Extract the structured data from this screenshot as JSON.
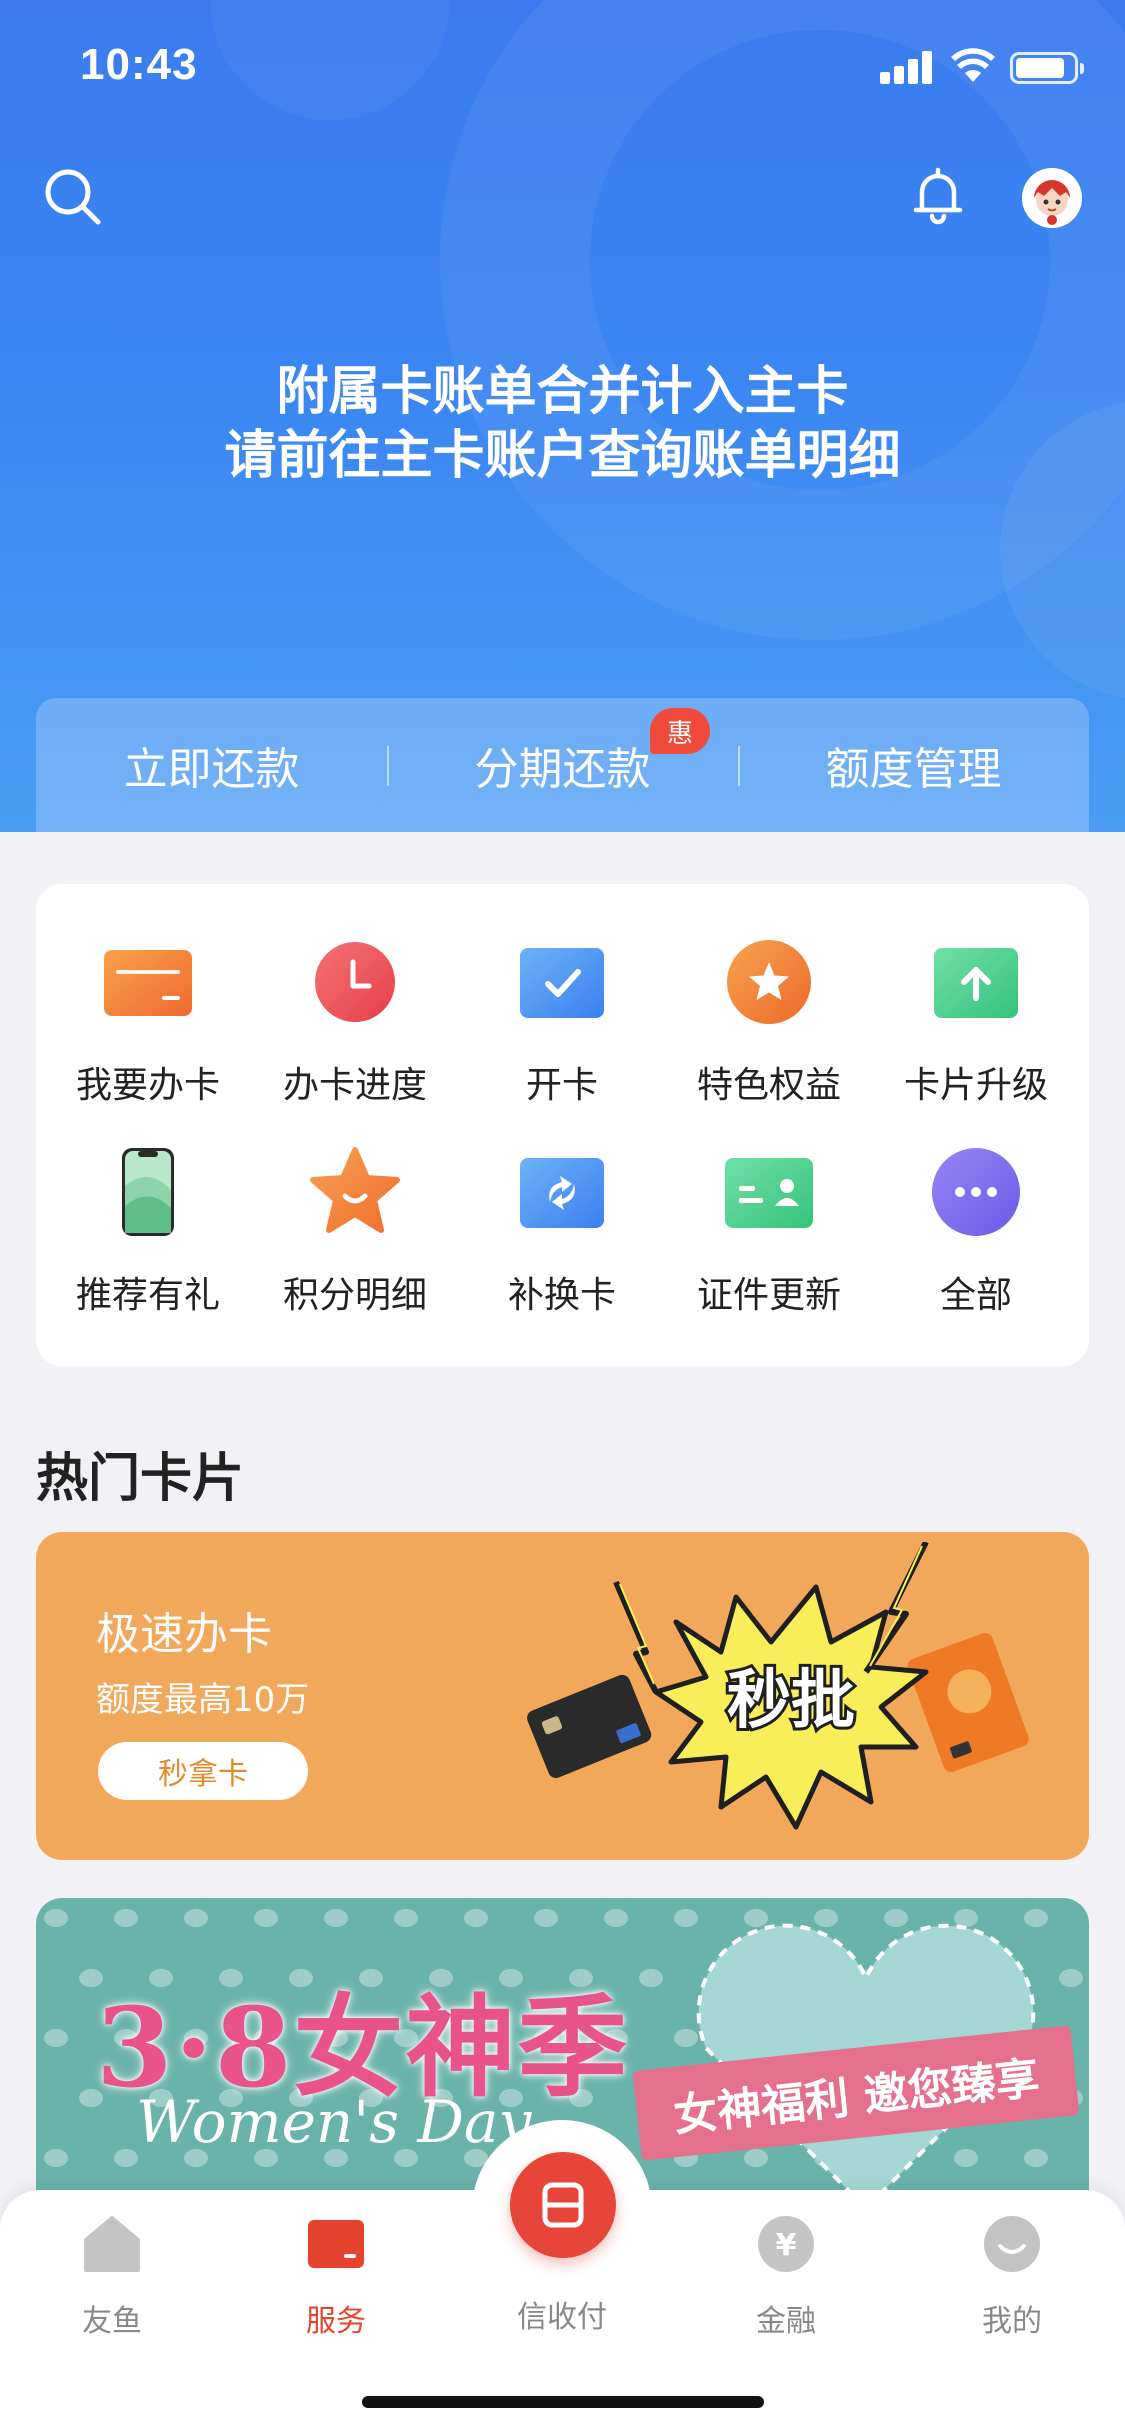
{
  "status_bar": {
    "time": "10:43",
    "signal_bars": 4,
    "battery_level": 0.85
  },
  "header": {
    "search_icon": "search-icon",
    "bell_icon": "bell-icon",
    "notice_line1": "附属卡账单合并计入主卡",
    "notice_line2": "请前往主卡账户查询账单明细"
  },
  "quick_actions": [
    {
      "label": "立即还款"
    },
    {
      "label": "分期还款",
      "badge": "惠"
    },
    {
      "label": "额度管理"
    }
  ],
  "services": [
    {
      "label": "我要办卡",
      "icon": "card-icon",
      "color": "#f2813b"
    },
    {
      "label": "办卡进度",
      "icon": "clock-icon",
      "color": "#ee5050"
    },
    {
      "label": "开卡",
      "icon": "check-icon",
      "color": "#4a90f0"
    },
    {
      "label": "特色权益",
      "icon": "star-badge-icon",
      "color": "#f0802e"
    },
    {
      "label": "卡片升级",
      "icon": "upgrade-icon",
      "color": "#4ccf8c"
    },
    {
      "label": "推荐有礼",
      "icon": "phone-icon",
      "color": "#6fc8a2"
    },
    {
      "label": "积分明细",
      "icon": "star-icon",
      "color": "#f2863a"
    },
    {
      "label": "补换卡",
      "icon": "exchange-icon",
      "color": "#4a90f0"
    },
    {
      "label": "证件更新",
      "icon": "id-card-icon",
      "color": "#4ccf8c"
    },
    {
      "label": "全部",
      "icon": "more-icon",
      "color": "#7f6ff0"
    }
  ],
  "hot_cards": {
    "title": "热门卡片",
    "promo": {
      "title": "极速办卡",
      "subtitle": "额度最高10万",
      "button": "秒拿卡",
      "burst_text": "秒批"
    },
    "promo2": {
      "title": "3·8女神季",
      "subtitle": "Women's Day",
      "ribbon": "女神福利 邀您臻享"
    }
  },
  "tabbar": [
    {
      "label": "友鱼",
      "icon": "home-icon",
      "active": false
    },
    {
      "label": "服务",
      "icon": "service-card-icon",
      "active": true
    },
    {
      "label": "信收付",
      "icon": "scan-icon",
      "active": false
    },
    {
      "label": "金融",
      "icon": "yuan-icon",
      "active": false
    },
    {
      "label": "我的",
      "icon": "profile-icon",
      "active": false
    }
  ]
}
